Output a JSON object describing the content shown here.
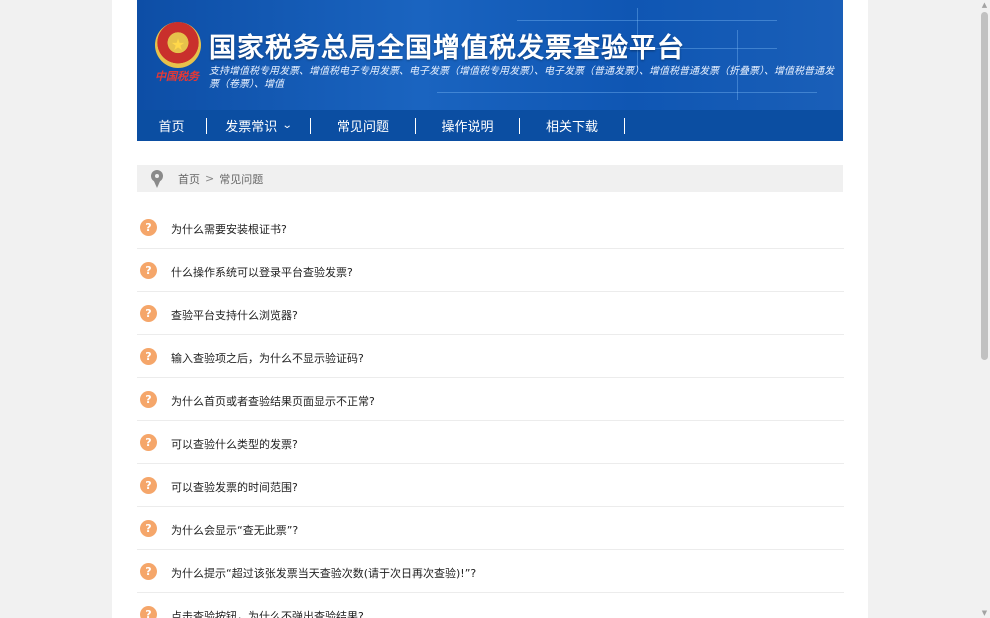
{
  "header": {
    "seal_text": "中国税务",
    "title": "国家税务总局全国增值税发票查验平台",
    "subtitle": "支持增值税专用发票、增值税电子专用发票、电子发票（增值税专用发票）、电子发票（普通发票）、增值税普通发票（折叠票）、增值税普通发票（卷票）、增值"
  },
  "nav": {
    "items": [
      {
        "label": "首页"
      },
      {
        "label": "发票常识"
      },
      {
        "label": "常见问题"
      },
      {
        "label": "操作说明"
      },
      {
        "label": "相关下载"
      }
    ]
  },
  "breadcrumb": {
    "home": "首页",
    "separator": ">",
    "current": "常见问题"
  },
  "faq": {
    "items": [
      {
        "icon": "?",
        "question": "为什么需要安装根证书?"
      },
      {
        "icon": "?",
        "question": "什么操作系统可以登录平台查验发票?"
      },
      {
        "icon": "?",
        "question": "查验平台支持什么浏览器?"
      },
      {
        "icon": "?",
        "question": "输入查验项之后，为什么不显示验证码?"
      },
      {
        "icon": "?",
        "question": "为什么首页或者查验结果页面显示不正常?"
      },
      {
        "icon": "?",
        "question": "可以查验什么类型的发票?"
      },
      {
        "icon": "?",
        "question": "可以查验发票的时间范围?"
      },
      {
        "icon": "?",
        "question": "为什么会显示“查无此票”?"
      },
      {
        "icon": "?",
        "question": "为什么提示“超过该张发票当天查验次数(请于次日再次查验)!”?"
      },
      {
        "icon": "?",
        "question": "点击查验按钮，为什么不弹出查验结果?"
      }
    ]
  },
  "colors": {
    "banner": "#1a64c0",
    "nav": "#0b4ea2",
    "question_icon": "#f5a66a"
  }
}
